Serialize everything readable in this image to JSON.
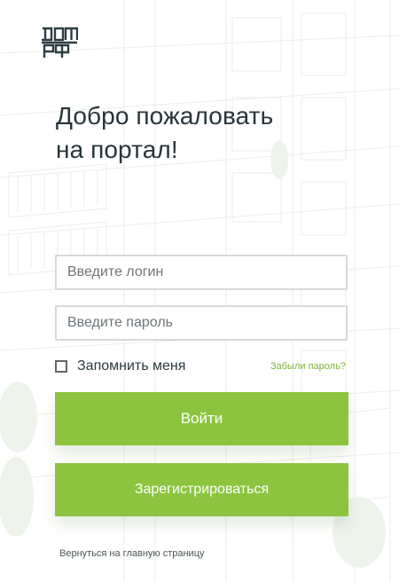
{
  "brand": {
    "logo_icon": "dom-rf-logo-icon",
    "logo_color": "#2e3d44",
    "logo_text": "ДОМ РФ"
  },
  "welcome": {
    "line1": "Добро пожаловать",
    "line2": "на портал!"
  },
  "form": {
    "login_placeholder": "Введите логин",
    "login_value": "",
    "password_placeholder": "Введите пароль",
    "password_value": "",
    "remember_label": "Запомнить меня",
    "remember_checked": false,
    "forgot_label": "Забыли пароль?"
  },
  "buttons": {
    "login_label": "Войти",
    "register_label": "Зарегистрироваться"
  },
  "footer": {
    "back_link": "Вернуться на главную страницу"
  },
  "colors": {
    "accent": "#8cc43f",
    "link": "#7db33c",
    "field_border": "#d7dadb",
    "heading": "#27353b"
  },
  "icons": [
    "dom-rf-logo-icon",
    "checkbox-icon"
  ]
}
